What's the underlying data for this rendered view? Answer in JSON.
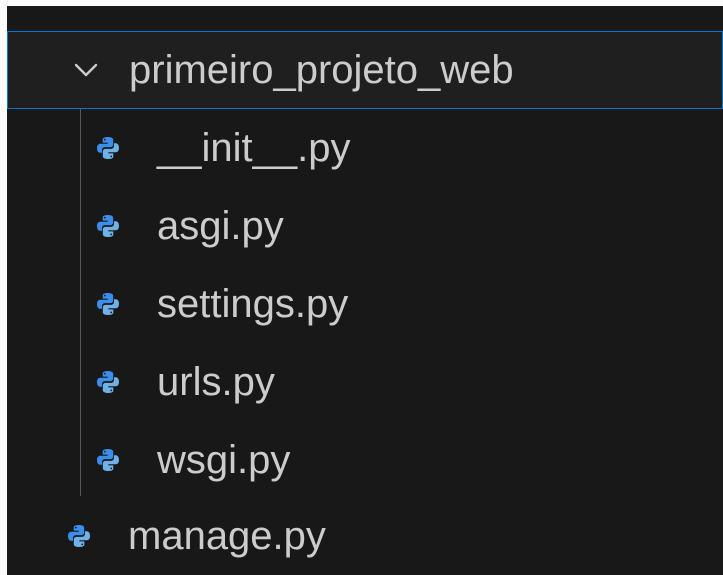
{
  "explorer": {
    "folder": {
      "label": "primeiro_projeto_web",
      "expanded_icon": "chevron-down-icon"
    },
    "children": [
      {
        "label": "__init__.py",
        "icon": "python-file-icon"
      },
      {
        "label": "asgi.py",
        "icon": "python-file-icon"
      },
      {
        "label": "settings.py",
        "icon": "python-file-icon"
      },
      {
        "label": "urls.py",
        "icon": "python-file-icon"
      },
      {
        "label": "wsgi.py",
        "icon": "python-file-icon"
      }
    ],
    "root_files": [
      {
        "label": "manage.py",
        "icon": "python-file-icon"
      }
    ]
  },
  "colors": {
    "background": "#181818",
    "text": "#cccccc",
    "selection_border": "#0078d4",
    "python_blue": "#3b8eea",
    "python_light": "#6fb2e8"
  }
}
